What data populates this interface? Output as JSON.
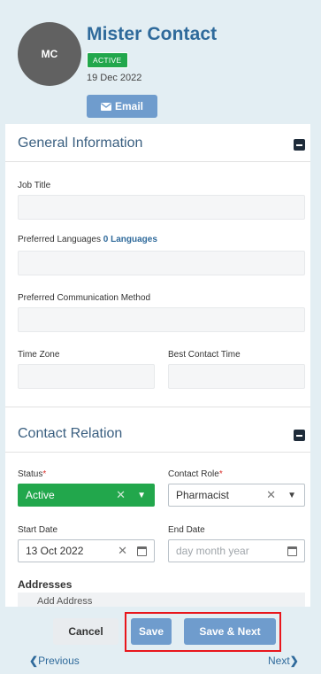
{
  "contact": {
    "initials": "MC",
    "name": "Mister Contact",
    "status_badge": "ACTIVE",
    "created_date": "19 Dec 2022",
    "email_button": "Email"
  },
  "general_info": {
    "title": "General Information",
    "job_title_label": "Job Title",
    "preferred_languages_label": "Preferred Languages",
    "preferred_languages_link": "0 Languages",
    "preferred_comm_label": "Preferred Communication Method",
    "time_zone_label": "Time Zone",
    "best_contact_time_label": "Best Contact Time"
  },
  "contact_relation": {
    "title": "Contact Relation",
    "status_label": "Status",
    "status_value": "Active",
    "contact_role_label": "Contact Role",
    "contact_role_value": "Pharmacist",
    "start_date_label": "Start Date",
    "start_date_value": "13 Oct 2022",
    "end_date_label": "End Date",
    "end_date_placeholder": "day month year",
    "addresses_label": "Addresses",
    "add_address_text": "Add Address"
  },
  "footer": {
    "cancel": "Cancel",
    "save": "Save",
    "save_next": "Save & Next",
    "previous": "Previous",
    "next": "Next"
  },
  "colors": {
    "accent": "#2f6a9b",
    "button": "#6f9ccd",
    "active_green": "#22a74c",
    "highlight": "#e8161c"
  }
}
